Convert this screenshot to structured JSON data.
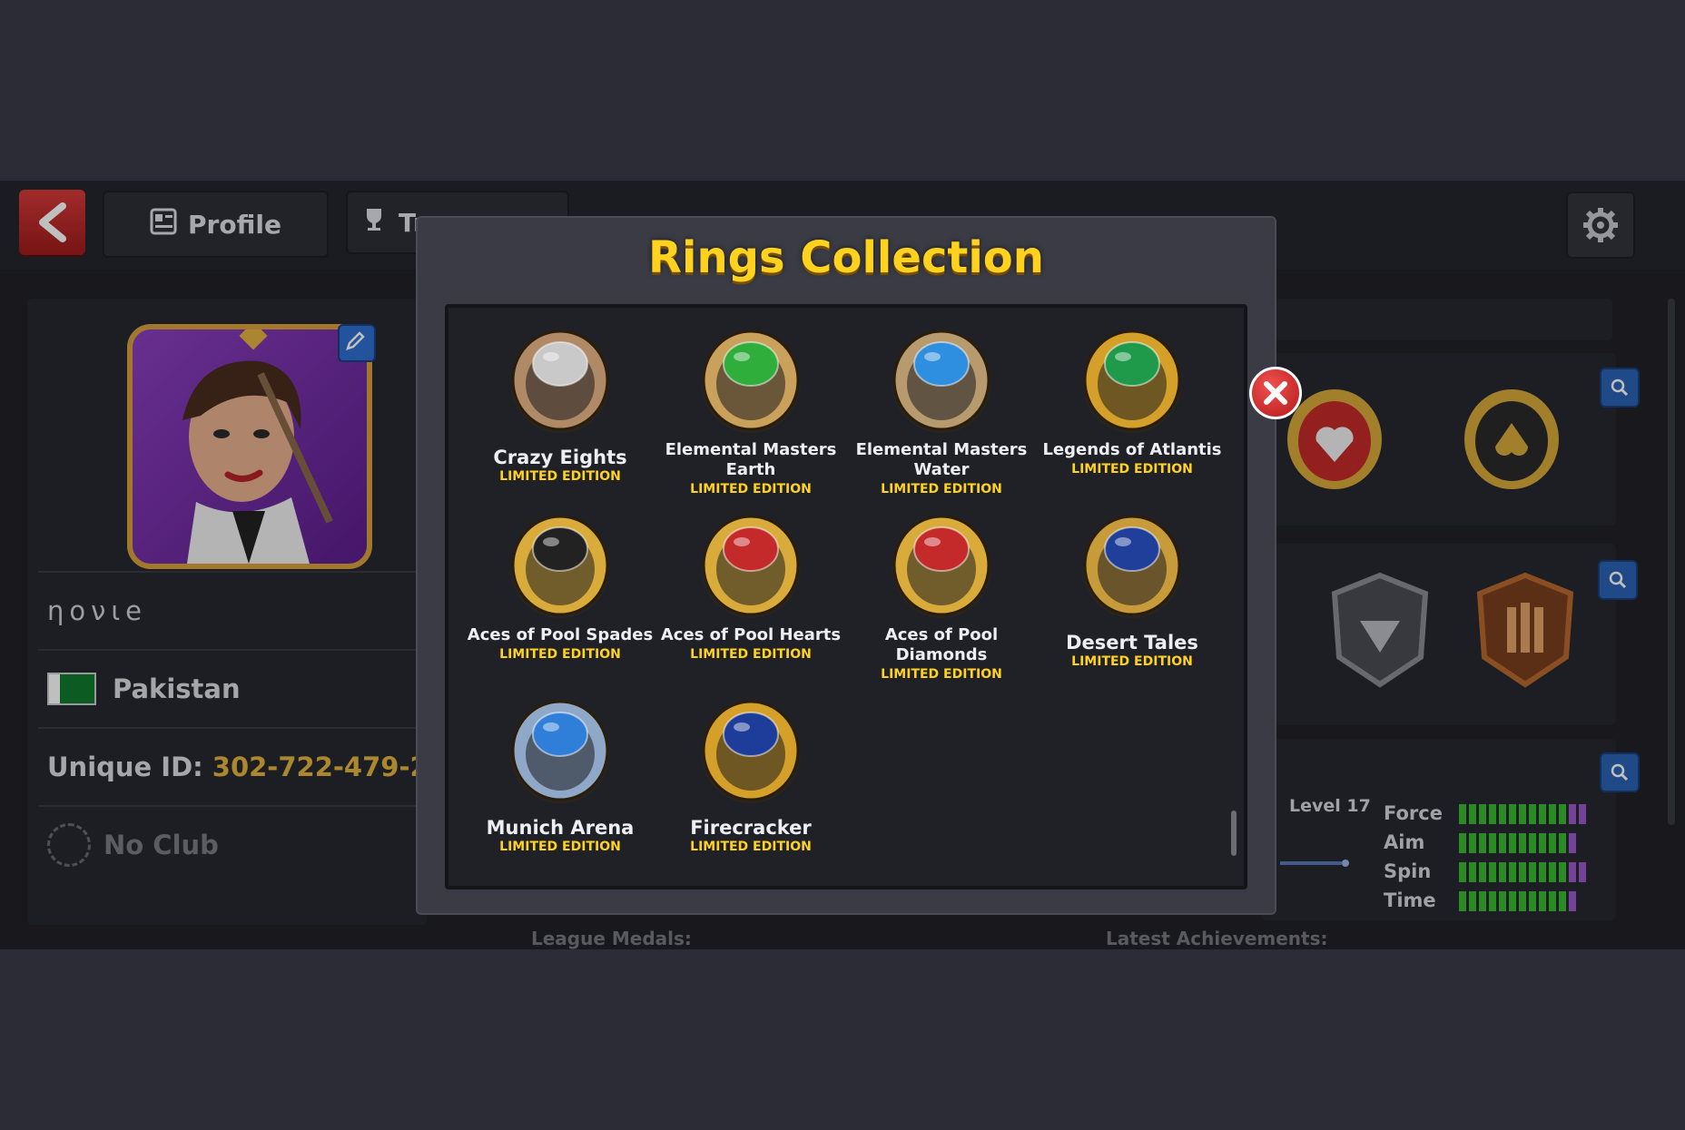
{
  "topbar": {
    "back_icon": "chevron-left-icon",
    "tabs": [
      {
        "label": "Profile",
        "icon": "profile-card-icon"
      },
      {
        "label": "Tr",
        "icon": "trophy-icon"
      }
    ],
    "settings_icon": "gear-icon"
  },
  "profile": {
    "username": "ηονιe",
    "country": "Pakistan",
    "unique_id_label": "Unique ID:",
    "unique_id": "302-722-479-2",
    "club": "No Club"
  },
  "stats": {
    "level_label": "Level 17",
    "rows": [
      {
        "label": "Force",
        "green": 11,
        "purple": 2
      },
      {
        "label": "Aim",
        "green": 11,
        "purple": 1
      },
      {
        "label": "Spin",
        "green": 11,
        "purple": 2
      },
      {
        "label": "Time",
        "green": 11,
        "purple": 1
      }
    ]
  },
  "footer": {
    "league_medals": "League Medals:",
    "latest_achievements": "Latest Achievements:"
  },
  "modal": {
    "title": "Rings Collection",
    "close_icon": "close-icon",
    "rings": [
      {
        "name": "Crazy Eights",
        "edition": "LIMITED EDITION",
        "color": "#b08a66",
        "gem": "#c9c9c9"
      },
      {
        "name": "Elemental Masters Earth",
        "edition": "LIMITED EDITION",
        "color": "#c9a15a",
        "gem": "#2fae3c"
      },
      {
        "name": "Elemental Masters Water",
        "edition": "LIMITED EDITION",
        "color": "#b79a6e",
        "gem": "#2e8fe0"
      },
      {
        "name": "Legends of Atlantis",
        "edition": "LIMITED EDITION",
        "color": "#d4a02a",
        "gem": "#1f9a4a"
      },
      {
        "name": "Aces of Pool Spades",
        "edition": "LIMITED EDITION",
        "color": "#d9ab3a",
        "gem": "#222222"
      },
      {
        "name": "Aces of Pool Hearts",
        "edition": "LIMITED EDITION",
        "color": "#d9ab3a",
        "gem": "#c52a2a"
      },
      {
        "name": "Aces of Pool Diamonds",
        "edition": "LIMITED EDITION",
        "color": "#d9ab3a",
        "gem": "#c52a2a"
      },
      {
        "name": "Desert Tales",
        "edition": "LIMITED EDITION",
        "color": "#c79a3a",
        "gem": "#1f3f9a"
      },
      {
        "name": "Munich Arena",
        "edition": "LIMITED EDITION",
        "color": "#8fa8c8",
        "gem": "#2f7fd8"
      },
      {
        "name": "Firecracker",
        "edition": "LIMITED EDITION",
        "color": "#d4a02a",
        "gem": "#1e3c9a"
      }
    ]
  },
  "colors": {
    "accent_gold": "#ffd21f",
    "close_red": "#d42828",
    "back_red": "#c62d2d"
  }
}
